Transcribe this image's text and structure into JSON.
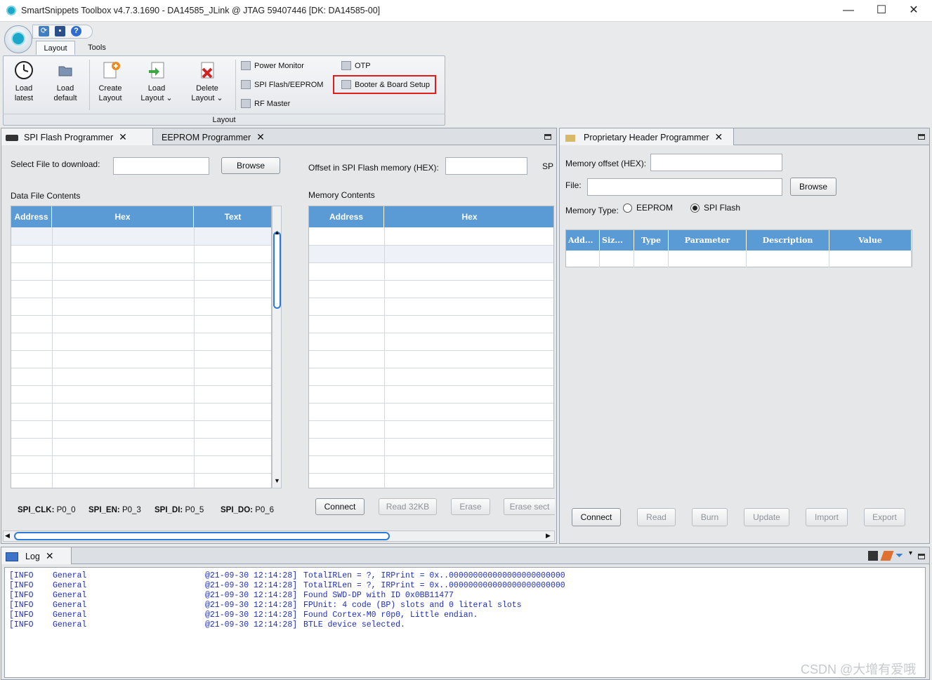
{
  "window": {
    "title": "SmartSnippets Toolbox v4.7.3.1690 - DA14585_JLink @ JTAG 59407446 [DK: DA14585-00]",
    "minimize": "—",
    "maximize": "☐",
    "close": "✕"
  },
  "ribbon": {
    "tabs": [
      "Layout",
      "Tools"
    ],
    "buttons": {
      "load_latest": [
        "Load",
        "latest"
      ],
      "load_default": [
        "Load",
        "default"
      ],
      "create_layout": [
        "Create",
        "Layout"
      ],
      "load_layout": [
        "Load",
        "Layout ⌄"
      ],
      "delete_layout": [
        "Delete",
        "Layout ⌄"
      ]
    },
    "tools": {
      "power_monitor": "Power Monitor",
      "spi_flash_eeprom": "SPI Flash/EEPROM",
      "rf_master": "RF Master",
      "otp": "OTP",
      "booter_board_setup": "Booter & Board Setup"
    },
    "group_label": "Layout"
  },
  "spi_panel": {
    "tabs": [
      "SPI Flash Programmer",
      "EEPROM Programmer"
    ],
    "select_file_label": "Select File to download:",
    "browse": "Browse",
    "offset_label": "Offset in SPI Flash memory (HEX):",
    "offset_trailing": "SP",
    "data_file_contents": "Data File Contents",
    "memory_contents": "Memory Contents",
    "data_columns": [
      "Address",
      "Hex",
      "Text"
    ],
    "memory_columns": [
      "Address",
      "Hex"
    ],
    "pins": [
      {
        "name": "SPI_CLK:",
        "value": "P0_0"
      },
      {
        "name": "SPI_EN:",
        "value": "P0_3"
      },
      {
        "name": "SPI_DI:",
        "value": "P0_5"
      },
      {
        "name": "SPI_DO:",
        "value": "P0_6"
      }
    ],
    "actions": {
      "connect": "Connect",
      "read": "Read 32KB",
      "erase": "Erase",
      "erase_sector": "Erase sect"
    }
  },
  "header_panel": {
    "tab": "Proprietary Header Programmer",
    "memory_offset_label": "Memory offset (HEX):",
    "file_label": "File:",
    "browse": "Browse",
    "memory_type_label": "Memory Type:",
    "memory_types": [
      "EEPROM",
      "SPI Flash"
    ],
    "selected_memory_type": "SPI Flash",
    "columns": [
      "Add...",
      "Siz...",
      "Type",
      "Parameter",
      "Description",
      "Value"
    ],
    "actions": [
      "Connect",
      "Read",
      "Burn",
      "Update",
      "Import",
      "Export"
    ]
  },
  "log": {
    "tab": "Log",
    "rows": [
      {
        "level": "[INFO",
        "category": "General",
        "time": "@21-09-30 12:14:28]",
        "message": "TotalIRLen = ?, IRPrint = 0x..000000000000000000000000"
      },
      {
        "level": "[INFO",
        "category": "General",
        "time": "@21-09-30 12:14:28]",
        "message": "TotalIRLen = ?, IRPrint = 0x..000000000000000000000000"
      },
      {
        "level": "[INFO",
        "category": "General",
        "time": "@21-09-30 12:14:28]",
        "message": "Found SWD-DP with ID 0x0BB11477"
      },
      {
        "level": "[INFO",
        "category": "General",
        "time": "@21-09-30 12:14:28]",
        "message": "FPUnit: 4 code (BP) slots and 0 literal slots"
      },
      {
        "level": "[INFO",
        "category": "General",
        "time": "@21-09-30 12:14:28]",
        "message": "Found Cortex-M0 r0p0, Little endian."
      },
      {
        "level": "[INFO",
        "category": "General",
        "time": "@21-09-30 12:14:28]",
        "message": "BTLE device selected."
      }
    ]
  },
  "watermark": "CSDN @大增有爱哦",
  "colors": {
    "grid_header": "#5a9bd5",
    "highlight": "#e21b1b",
    "log_text": "#1f2fb8"
  }
}
